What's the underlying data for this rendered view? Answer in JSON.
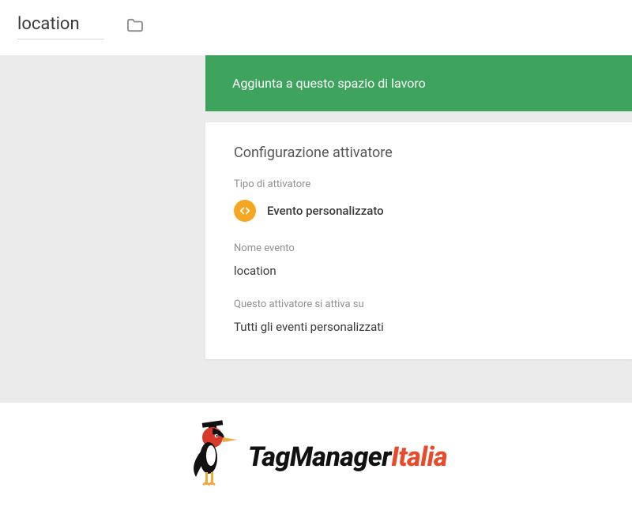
{
  "header": {
    "title": "location"
  },
  "banner": {
    "text": "Aggiunta a questo spazio di lavoro"
  },
  "card": {
    "title": "Configurazione attivatore",
    "trigger_type_label": "Tipo di attivatore",
    "trigger_type_value": "Evento personalizzato",
    "event_name_label": "Nome evento",
    "event_name_value": "location",
    "fires_on_label": "Questo attivatore si attiva su",
    "fires_on_value": "Tutti gli eventi personalizzati"
  },
  "footer": {
    "logo_part1": "TagManager",
    "logo_part2": "Italia"
  }
}
